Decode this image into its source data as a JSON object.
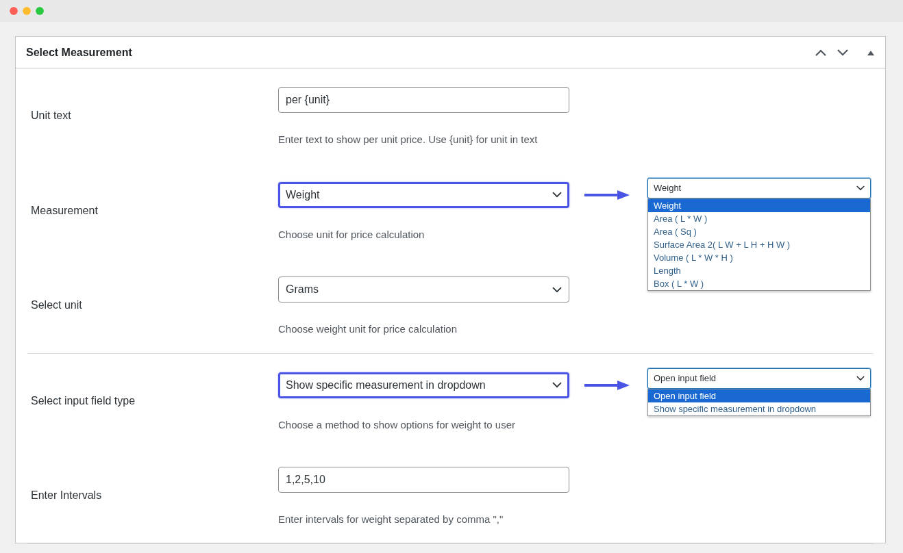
{
  "panel": {
    "title": "Select Measurement"
  },
  "sections": [
    {
      "rows": [
        {
          "label": "Unit text",
          "kind": "text",
          "value": "per {unit}",
          "highlighted": false,
          "help": "Enter text to show per unit price. Use {unit} for unit in text"
        },
        {
          "label": "Measurement",
          "kind": "select",
          "value": "Weight",
          "highlighted": true,
          "help": "Choose unit for price calculation",
          "popup": {
            "value": "Weight",
            "options": [
              {
                "label": "Weight",
                "selected": true
              },
              {
                "label": "Area ( L * W )",
                "selected": false
              },
              {
                "label": "Area ( Sq )",
                "selected": false
              },
              {
                "label": "Surface Area 2( L W + L H + H W )",
                "selected": false
              },
              {
                "label": "Volume ( L * W * H )",
                "selected": false
              },
              {
                "label": "Length",
                "selected": false
              },
              {
                "label": "Box ( L * W )",
                "selected": false
              }
            ]
          }
        },
        {
          "label": "Select unit",
          "kind": "select",
          "value": "Grams",
          "highlighted": false,
          "help": "Choose weight unit for price calculation"
        }
      ]
    },
    {
      "rows": [
        {
          "label": "Select input field type",
          "kind": "select",
          "value": "Show specific measurement in dropdown",
          "highlighted": true,
          "help": "Choose a method to show options for weight to user",
          "popup": {
            "value": "Open input field",
            "options": [
              {
                "label": "Open input field",
                "selected": true
              },
              {
                "label": "Show specific measurement in dropdown",
                "selected": false
              }
            ]
          }
        },
        {
          "label": "Enter Intervals",
          "kind": "text",
          "value": "1,2,5,10",
          "highlighted": false,
          "help": "Enter intervals for weight separated by comma \",\""
        }
      ]
    }
  ]
}
